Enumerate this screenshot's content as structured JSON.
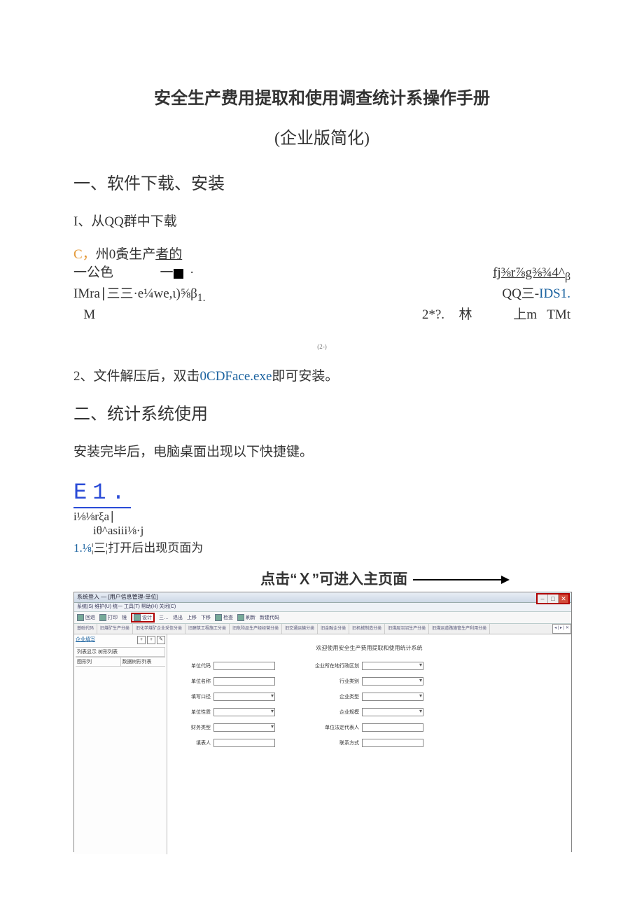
{
  "title": "安全生产费用提取和使用调查统计系操作手册",
  "subtitle": "(企业版简化)",
  "section1": {
    "heading": "一、软件下载、安装",
    "item1": "I、从QQ群中下载",
    "c_line": {
      "c": "C，",
      "rest": "州0夤生产",
      "link": "者的"
    },
    "row1": {
      "left_a": "一公色",
      "left_b": "一",
      "dot": "·",
      "right": "fj⅜r⅞g⅜¾4^",
      "sub": "β"
    },
    "row2": {
      "left": "IMra∣三三·e¼we,ι)⅝β",
      "leftsub": "1.",
      "right_a": "QQ三-",
      "right_b": "IDS1."
    },
    "row3": {
      "m": "M",
      "mid": "2*?.",
      "lin": "林",
      "up": "上m",
      "tmt": "TMt"
    },
    "midmark": "(2-)",
    "item2_a": "2、文件解压后，双击",
    "item2_b": "0CDFace.exe",
    "item2_c": "即可安装。"
  },
  "section2": {
    "heading": "二、统计系统使用",
    "intro": "安装完毕后，电脑桌面出现以下快捷键。",
    "e1": "E1.",
    "gib1": "i⅛⅛rξa∣",
    "gib2": "iθ^asiii⅛·j",
    "open_a": "1.⅛",
    "open_b": "¦三¦",
    "open_c": "打开后出现页面为",
    "callout": "点击“Ｘ”可进入主页面"
  },
  "app": {
    "title": "系统登入 — [用户信息管理-单位]",
    "menus": "系统(S)  维护(U)  统一  工具(T)  帮助(H)  关闭(C)",
    "toolbar": [
      "回退",
      "打印",
      "镜",
      "设计",
      "三…",
      "退出",
      "上移",
      "下移",
      "上移",
      "检查",
      "刷新",
      "新建代码"
    ],
    "hl_tool": "设计",
    "side": {
      "link": "企业填写",
      "col1_a": "列表显示",
      "col1_b": "树形列表",
      "col2_a": "图形列",
      "col2_b": "数据树形列表"
    },
    "tabs": [
      "基础代码",
      "旧煤矿生产分类",
      "旧化学煤矿企业采信分类",
      "旧建筑工程施工分类",
      "旧危险品生产经经营分类",
      "旧交通运输分类",
      "旧金融企分类",
      "旧机械制造分类",
      "旧煤层沼沼生产分类",
      "旧煤运道路施管生产利用分类"
    ],
    "tab_nav": "◂ | ▸ | ✕",
    "form": {
      "title": "欢迎使用安全生产费用提取和使用统计系统",
      "rows": [
        [
          "单位代码",
          "企业所在地行政区划"
        ],
        [
          "单位名称",
          "行业类别"
        ],
        [
          "填写口径",
          "企业类型"
        ],
        [
          "单位性质",
          "企业规模"
        ],
        [
          "财务类型",
          "单位法定代表人"
        ],
        [
          "填表人",
          "联系方式"
        ]
      ]
    }
  }
}
